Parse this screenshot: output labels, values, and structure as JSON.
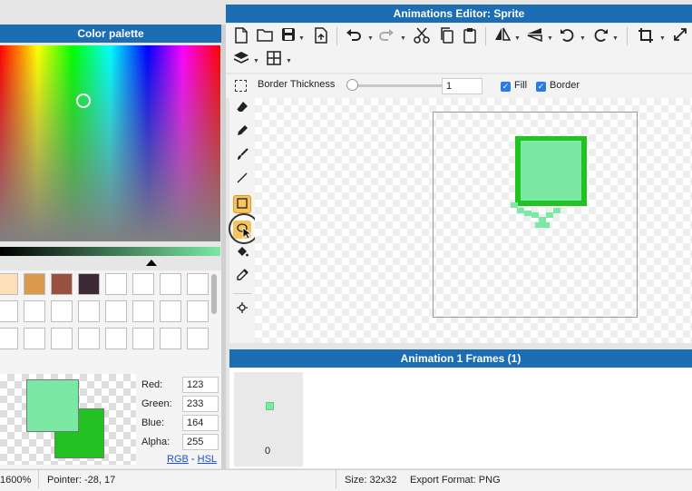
{
  "window": {
    "title": "Animations Editor: Sprite"
  },
  "palette": {
    "header": "Color palette",
    "swatches_row1": [
      "#fde0b8",
      "#d99a4e",
      "#9a5040",
      "#3e2a36"
    ],
    "fg_color": "#7be9a4",
    "bg_color": "#22c222",
    "labels": {
      "red": "Red:",
      "green": "Green:",
      "blue": "Blue:",
      "alpha": "Alpha:"
    },
    "values": {
      "red": "123",
      "green": "233",
      "blue": "164",
      "alpha": "255"
    },
    "modes": {
      "rgb": "RGB",
      "sep": "-",
      "hsl": "HSL"
    }
  },
  "toolbar": {
    "icons": [
      "new-file-icon",
      "open-folder-icon",
      "save-icon",
      "export-icon",
      "undo-icon",
      "redo-icon",
      "cut-icon",
      "copy-icon",
      "paste-icon",
      "flip-horizontal-icon",
      "flip-vertical-icon",
      "rotate-left-icon",
      "rotate-right-icon",
      "crop-icon",
      "fullscreen-icon",
      "layers-icon",
      "grid-icon"
    ]
  },
  "options": {
    "border_thickness_label": "Border Thickness",
    "border_thickness_value": "1",
    "fill_label": "Fill",
    "fill_checked": true,
    "border_label": "Border",
    "border_checked": true
  },
  "frames": {
    "header": "Animation 1 Frames (1)",
    "items": [
      {
        "label": "0"
      }
    ]
  },
  "status": {
    "zoom": "1600%",
    "pointer": "Pointer: -28, 17",
    "size": "Size: 32x32",
    "export_format": "Export Format: PNG"
  }
}
